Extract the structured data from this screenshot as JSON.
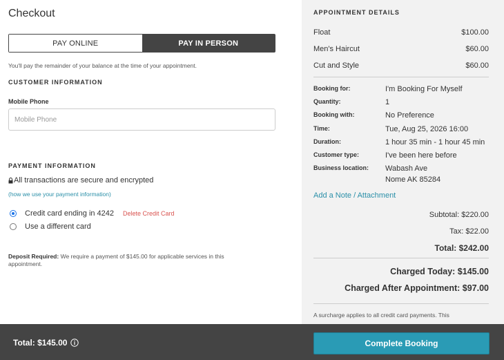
{
  "checkout": {
    "title": "Checkout",
    "pay_options": {
      "online": "PAY ONLINE",
      "in_person": "PAY IN PERSON",
      "selected": "in_person"
    },
    "balance_note": "You'll pay the remainder of your balance at the time of your appointment.",
    "customer_info": {
      "heading": "CUSTOMER INFORMATION",
      "phone_label": "Mobile Phone",
      "phone_placeholder": "Mobile Phone",
      "phone_value": ""
    },
    "payment_info": {
      "heading": "PAYMENT INFORMATION",
      "secure_text": "All transactions are secure and encrypted",
      "how_link": "(how we use your payment information)",
      "cards": [
        {
          "label": "Credit card ending in 4242",
          "checked": true,
          "delete_label": "Delete Credit Card"
        },
        {
          "label": "Use a different card",
          "checked": false
        }
      ]
    },
    "deposit": {
      "label": "Deposit Required:",
      "text": "We require a payment of $145.00 for applicable services in this appointment."
    }
  },
  "appointment": {
    "heading": "APPOINTMENT DETAILS",
    "services": [
      {
        "name": "Float",
        "price": "$100.00"
      },
      {
        "name": "Men's Haircut",
        "price": "$60.00"
      },
      {
        "name": "Cut and Style",
        "price": "$60.00"
      }
    ],
    "details": [
      {
        "key": "Booking for:",
        "value": "I'm Booking For Myself"
      },
      {
        "key": "Quantity:",
        "value": "1"
      },
      {
        "key": "Booking with:",
        "value": "No Preference"
      },
      {
        "key": "Time:",
        "value": "Tue, Aug 25, 2026 16:00"
      },
      {
        "key": "Duration:",
        "value": "1 hour 35 min - 1 hour 45 min"
      },
      {
        "key": "Customer type:",
        "value": "I've been here before"
      },
      {
        "key": "Business location:",
        "value": "Wabash Ave",
        "value2": "Nome AK 85284"
      }
    ],
    "add_note": "Add a Note / Attachment",
    "subtotal": "Subtotal: $220.00",
    "tax": "Tax: $22.00",
    "total": "Total: $242.00",
    "charged_today": "Charged Today: $145.00",
    "charged_after": "Charged After Appointment: $97.00",
    "surcharge": "A surcharge applies to all credit card payments. This"
  },
  "footer": {
    "total": "Total: $145.00",
    "complete_button": "Complete Booking"
  }
}
